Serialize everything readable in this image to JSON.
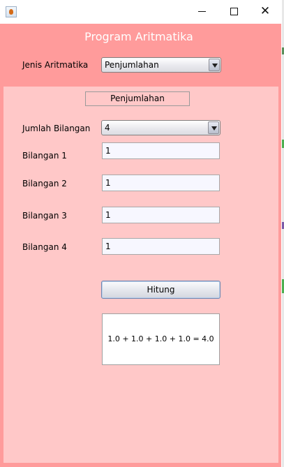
{
  "window": {
    "titlebar": {
      "title": "",
      "icon": "java-cup-icon",
      "controls": [
        "minimize-icon",
        "maximize-icon",
        "close-icon"
      ],
      "close_glyph": "✕"
    },
    "colors": {
      "frame_bg": "#ff9b9b",
      "panel_bg": "#ffc8c8",
      "title_text": "#ffffff"
    }
  },
  "header": {
    "title": "Program Aritmatika",
    "jenis_label": "Jenis Aritmatika",
    "jenis_selected": "Penjumlahan"
  },
  "panel": {
    "title": "Penjumlahan",
    "jumlah_label": "Jumlah Bilangan",
    "jumlah_selected": "4",
    "inputs": [
      {
        "label": "Bilangan 1",
        "value": "1"
      },
      {
        "label": "Bilangan 2",
        "value": "1"
      },
      {
        "label": "Bilangan 3",
        "value": "1"
      },
      {
        "label": "Bilangan 4",
        "value": "1"
      }
    ],
    "hitung_label": "Hitung",
    "result": "1.0 + 1.0 + 1.0 + 1.0 = 4.0"
  }
}
